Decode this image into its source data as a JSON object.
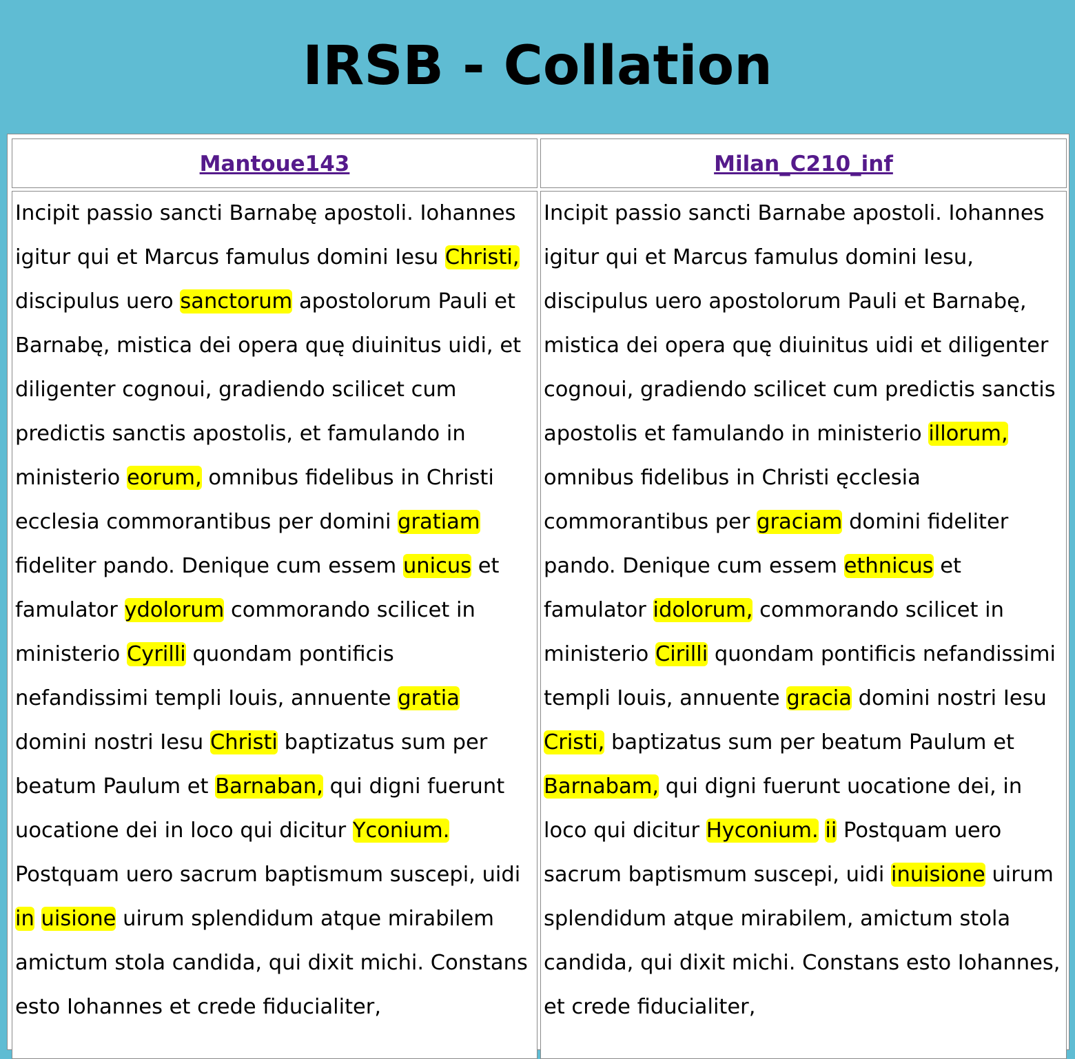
{
  "header": {
    "title": "IRSB - Collation"
  },
  "colors": {
    "background": "#5fbcd3",
    "highlight": "#ffff00",
    "link": "#551a8b"
  },
  "witnesses": [
    {
      "name": "Mantoue143",
      "segments": [
        {
          "t": "Incipit passio sancti Barnabę apostoli. Iohannes igitur qui et Marcus famulus domini Iesu "
        },
        {
          "t": "Christi,",
          "hl": true
        },
        {
          "t": " discipulus uero "
        },
        {
          "t": "sanctorum",
          "hl": true
        },
        {
          "t": " apostolorum Pauli et Barnabę, mistica dei opera quę diuinitus uidi, et diligenter cognoui, gradiendo scilicet cum predictis sanctis apostolis, et famulando in ministerio "
        },
        {
          "t": "eorum,",
          "hl": true
        },
        {
          "t": " omnibus fidelibus in Christi ecclesia commorantibus per domini "
        },
        {
          "t": "gratiam",
          "hl": true
        },
        {
          "t": " fideliter pando. Denique cum essem "
        },
        {
          "t": "unicus",
          "hl": true
        },
        {
          "t": " et famulator "
        },
        {
          "t": "ydolorum",
          "hl": true
        },
        {
          "t": " commorando scilicet in ministerio "
        },
        {
          "t": "Cyrilli",
          "hl": true
        },
        {
          "t": " quondam pontificis nefandissimi templi Iouis, annuente "
        },
        {
          "t": "gratia",
          "hl": true
        },
        {
          "t": " domini nostri Iesu "
        },
        {
          "t": "Christi",
          "hl": true
        },
        {
          "t": " baptizatus sum per beatum Paulum et "
        },
        {
          "t": "Barnaban,",
          "hl": true
        },
        {
          "t": " qui digni fuerunt uocatione dei in loco qui dicitur "
        },
        {
          "t": "Yconium.",
          "hl": true
        },
        {
          "t": " Postquam uero sacrum baptismum suscepi, uidi "
        },
        {
          "t": "in",
          "hl": true
        },
        {
          "t": " "
        },
        {
          "t": "uisione",
          "hl": true
        },
        {
          "t": " uirum splendidum atque mirabilem amictum stola candida, qui dixit michi. Constans esto Iohannes et crede fiducialiter,"
        }
      ]
    },
    {
      "name": "Milan_C210_inf",
      "segments": [
        {
          "t": "Incipit passio sancti Barnabe apostoli. Iohannes igitur qui et Marcus famulus domini Iesu, discipulus uero apostolorum Pauli et Barnabę, mistica dei opera quę diuinitus uidi et diligenter cognoui, gradiendo scilicet cum predictis sanctis apostolis et famulando in ministerio "
        },
        {
          "t": "illorum,",
          "hl": true
        },
        {
          "t": " omnibus fidelibus in Christi ęcclesia commorantibus per "
        },
        {
          "t": "graciam",
          "hl": true
        },
        {
          "t": " domini fideliter pando. Denique cum essem "
        },
        {
          "t": "ethnicus",
          "hl": true
        },
        {
          "t": " et famulator "
        },
        {
          "t": "idolorum,",
          "hl": true
        },
        {
          "t": " commorando scilicet in ministerio "
        },
        {
          "t": "Cirilli",
          "hl": true
        },
        {
          "t": " quondam pontificis nefandissimi templi Iouis, annuente "
        },
        {
          "t": "gracia",
          "hl": true
        },
        {
          "t": " domini nostri Iesu "
        },
        {
          "t": "Cristi,",
          "hl": true
        },
        {
          "t": " baptizatus sum per beatum Paulum et "
        },
        {
          "t": "Barnabam,",
          "hl": true
        },
        {
          "t": " qui digni fuerunt uocatione dei, in loco qui dicitur "
        },
        {
          "t": "Hyconium.",
          "hl": true
        },
        {
          "t": " "
        },
        {
          "t": "ii",
          "hl": true
        },
        {
          "t": " Postquam uero sacrum baptismum suscepi, uidi "
        },
        {
          "t": "inuisione",
          "hl": true
        },
        {
          "t": " uirum splendidum atque mirabilem, amictum stola candida, qui dixit michi. Constans esto Iohannes, et crede fiducialiter,"
        }
      ]
    }
  ]
}
